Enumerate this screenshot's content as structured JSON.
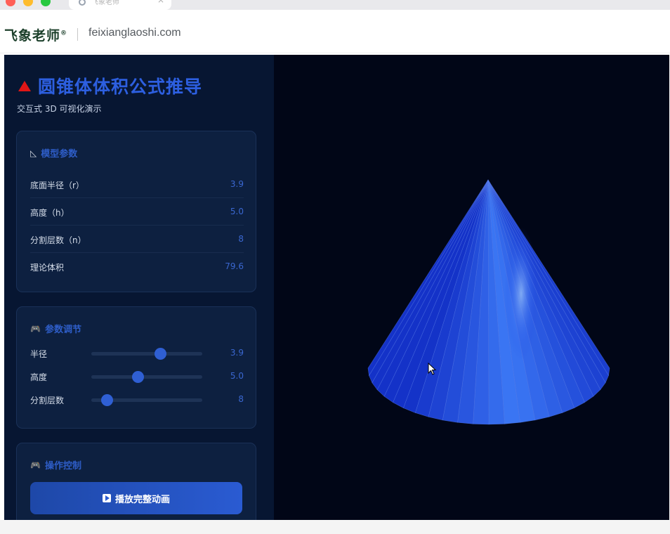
{
  "browser": {
    "tab_title": "飞象老师",
    "tab_close_icon": "close-icon"
  },
  "site": {
    "brand": "飞象老师",
    "brand_mark": "®",
    "domain": "feixianglaoshi.com"
  },
  "app": {
    "title": "圆锥体体积公式推导",
    "title_icon": "red-triangle-icon",
    "subtitle": "交互式 3D 可视化演示",
    "accent_color": "#2d5fe0",
    "background_color": "#010617"
  },
  "model_params": {
    "heading": "模型参数",
    "heading_icon": "ruler-triangle-icon",
    "rows": [
      {
        "label": "底面半径（r）",
        "value": "3.9"
      },
      {
        "label": "高度（h）",
        "value": "5.0"
      },
      {
        "label": "分割层数（n）",
        "value": "8"
      },
      {
        "label": "理论体积",
        "value": "79.6"
      }
    ]
  },
  "param_adjust": {
    "heading": "参数调节",
    "heading_icon": "gamepad-icon",
    "sliders": [
      {
        "label": "半径",
        "value": "3.9",
        "position": 0.62
      },
      {
        "label": "高度",
        "value": "5.0",
        "position": 0.42
      },
      {
        "label": "分割层数",
        "value": "8",
        "position": 0.14
      }
    ]
  },
  "controls": {
    "heading": "操作控制",
    "heading_icon": "gamepad-icon",
    "play_label": "播放完整动画",
    "play_icon": "play-icon"
  },
  "scene": {
    "object": "cone",
    "cone_color": "#1a3ce0",
    "segments": 24
  }
}
